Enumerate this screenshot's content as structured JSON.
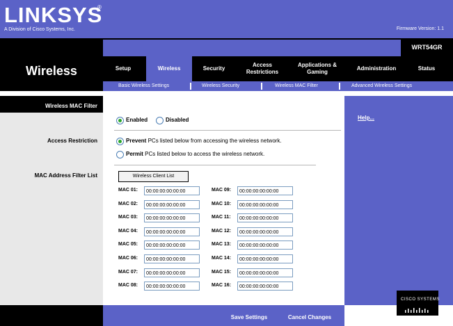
{
  "header": {
    "logo": "LINKSYS",
    "logo_reg": "®",
    "tagline": "A Division of Cisco Systems, Inc.",
    "firmware": "Firmware Version: 1.1",
    "model": "WRT54GR",
    "section": "Wireless"
  },
  "nav": {
    "items": [
      {
        "label": "Setup"
      },
      {
        "label": "Wireless"
      },
      {
        "label": "Security"
      },
      {
        "label": "Access Restrictions"
      },
      {
        "label": "Applications & Gaming"
      },
      {
        "label": "Administration"
      },
      {
        "label": "Status"
      }
    ],
    "active": "Wireless"
  },
  "subnav": {
    "items": [
      {
        "label": "Basic Wireless Settings"
      },
      {
        "label": "Wireless Security"
      },
      {
        "label": "Wireless MAC Filter"
      },
      {
        "label": "Advanced Wireless Settings"
      }
    ]
  },
  "form": {
    "mac_filter_label": "Wireless MAC Filter",
    "enabled_label": "Enabled",
    "disabled_label": "Disabled",
    "mac_filter_value": "Enabled",
    "access_restriction_label": "Access Restriction",
    "prevent_bold": "Prevent",
    "prevent_rest": " PCs listed below from accessing the wireless network.",
    "permit_bold": "Permit",
    "permit_rest": " PCs listed below to access the wireless network.",
    "access_restriction_value": "Prevent",
    "mac_list_label": "MAC Address Filter List",
    "client_list_button": "Wireless Client List",
    "macs": [
      {
        "label": "MAC 01:",
        "value": "00:00:00:00:00:00"
      },
      {
        "label": "MAC 02:",
        "value": "00:00:00:00:00:00"
      },
      {
        "label": "MAC 03:",
        "value": "00:00:00:00:00:00"
      },
      {
        "label": "MAC 04:",
        "value": "00:00:00:00:00:00"
      },
      {
        "label": "MAC 05:",
        "value": "00:00:00:00:00:00"
      },
      {
        "label": "MAC 06:",
        "value": "00:00:00:00:00:00"
      },
      {
        "label": "MAC 07:",
        "value": "00:00:00:00:00:00"
      },
      {
        "label": "MAC 08:",
        "value": "00:00:00:00:00:00"
      },
      {
        "label": "MAC 09:",
        "value": "00:00:00:00:00:00"
      },
      {
        "label": "MAC 10:",
        "value": "00:00:00:00:00:00"
      },
      {
        "label": "MAC 11:",
        "value": "00:00:00:00:00:00"
      },
      {
        "label": "MAC 12:",
        "value": "00:00:00:00:00:00"
      },
      {
        "label": "MAC 13:",
        "value": "00:00:00:00:00:00"
      },
      {
        "label": "MAC 14:",
        "value": "00:00:00:00:00:00"
      },
      {
        "label": "MAC 15:",
        "value": "00:00:00:00:00:00"
      },
      {
        "label": "MAC 16:",
        "value": "00:00:00:00:00:00"
      }
    ]
  },
  "help": {
    "link": "Help..."
  },
  "footer": {
    "save": "Save Settings",
    "cancel": "Cancel Changes",
    "cisco": "CISCO SYSTEMS"
  },
  "colors": {
    "brand_blue": "#5b62c7",
    "black": "#000000",
    "radio_green": "#2aa52a"
  }
}
